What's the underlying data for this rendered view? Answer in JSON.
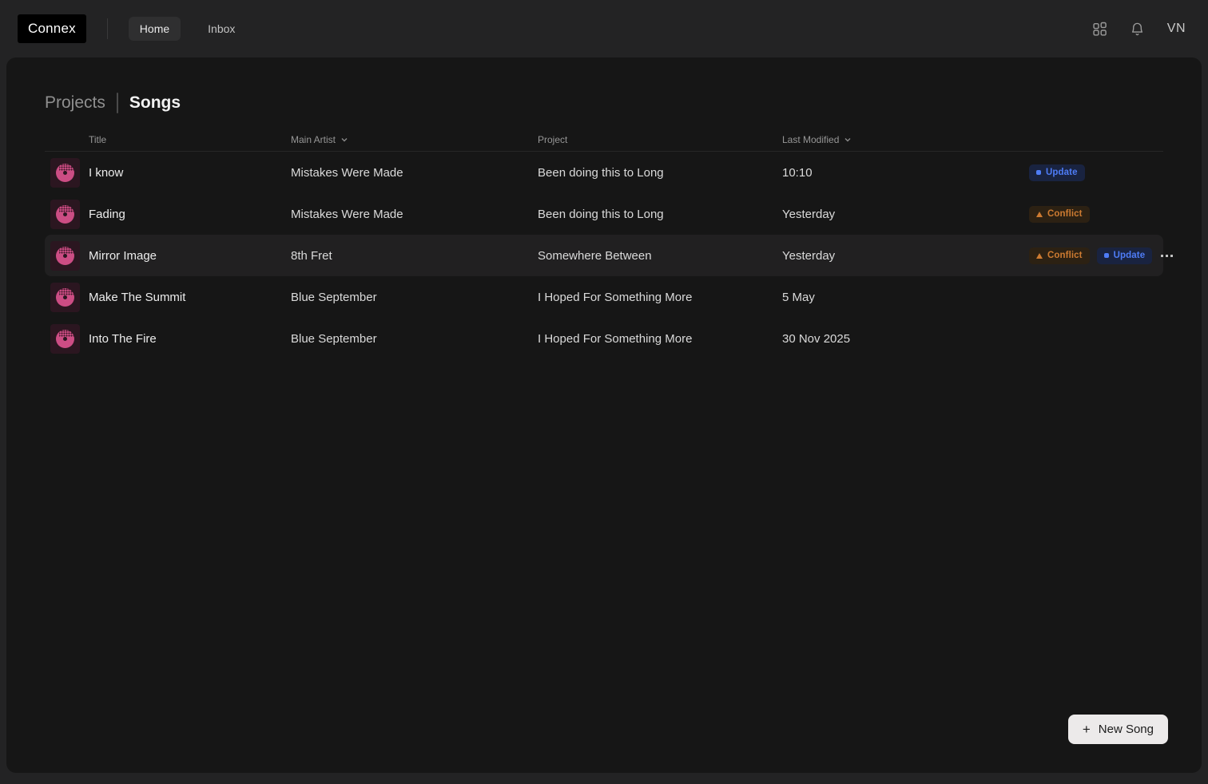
{
  "topbar": {
    "logo": "Connex",
    "tabs": [
      {
        "label": "Home",
        "active": true
      },
      {
        "label": "Inbox",
        "active": false
      }
    ],
    "user_initials": "VN"
  },
  "breadcrumb": {
    "parent": "Projects",
    "current": "Songs"
  },
  "table": {
    "headers": {
      "title": "Title",
      "artist": "Main Artist",
      "project": "Project",
      "modified": "Last Modified"
    },
    "rows": [
      {
        "title": "I know",
        "artist": "Mistakes Were Made",
        "project": "Been doing this to Long",
        "modified": "10:10",
        "badges": [
          "update"
        ]
      },
      {
        "title": "Fading",
        "artist": "Mistakes Were Made",
        "project": "Been doing this to Long",
        "modified": "Yesterday",
        "badges": [
          "conflict"
        ]
      },
      {
        "title": "Mirror Image",
        "artist": "8th Fret",
        "project": "Somewhere Between",
        "modified": "Yesterday",
        "badges": [
          "conflict",
          "update"
        ],
        "highlighted": true
      },
      {
        "title": "Make The Summit",
        "artist": "Blue September",
        "project": "I Hoped For Something More",
        "modified": "5 May",
        "badges": []
      },
      {
        "title": "Into The Fire",
        "artist": "Blue September",
        "project": "I Hoped For Something More",
        "modified": "30 Nov 2025",
        "badges": []
      }
    ]
  },
  "statuses": {
    "update": {
      "label": "Update",
      "color": "#4e7cf6",
      "bg": "#192340"
    },
    "conflict": {
      "label": "Conflict",
      "color": "#cd7b31",
      "bg": "#2c2113"
    }
  },
  "actions": {
    "new_song": "New Song",
    "plus": "+"
  },
  "colors": {
    "page_bg": "#232324",
    "panel_bg": "#161616",
    "highlight_row_bg": "#212021",
    "accent_pink": "#cc4d84",
    "tile_bg": "#2b1620",
    "button_bg": "#eceaea"
  }
}
